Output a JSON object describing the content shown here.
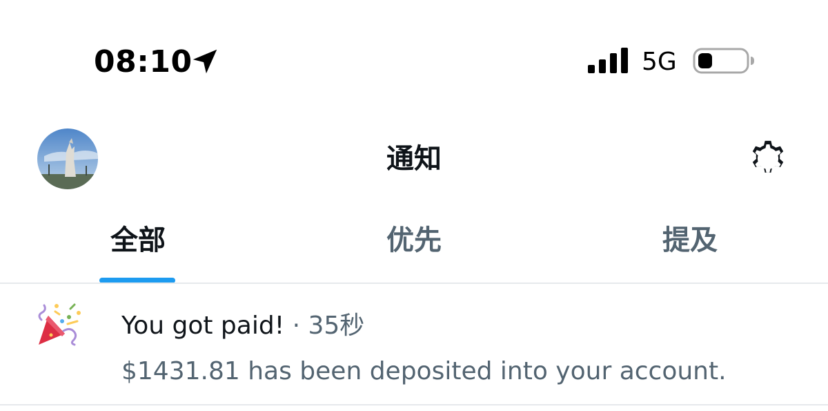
{
  "status_bar": {
    "time": "08:10",
    "network": "5G",
    "icons": [
      "location-arrow-icon",
      "cellular-signal-icon",
      "battery-icon"
    ]
  },
  "header": {
    "title": "通知",
    "avatar": "user-avatar",
    "settings_icon": "gear-icon"
  },
  "tabs": [
    {
      "label": "全部",
      "active": true
    },
    {
      "label": "优先",
      "active": false
    },
    {
      "label": "提及",
      "active": false
    }
  ],
  "notifications": [
    {
      "icon": "party-popper-icon",
      "title": "You got paid!",
      "separator": "·",
      "time": "35秒",
      "body": "$1431.81 has been deposited into your account."
    }
  ],
  "colors": {
    "accent": "#1d9bf0",
    "primary_text": "#0f1419",
    "secondary_text": "#536471",
    "divider": "#e6e9ec"
  }
}
